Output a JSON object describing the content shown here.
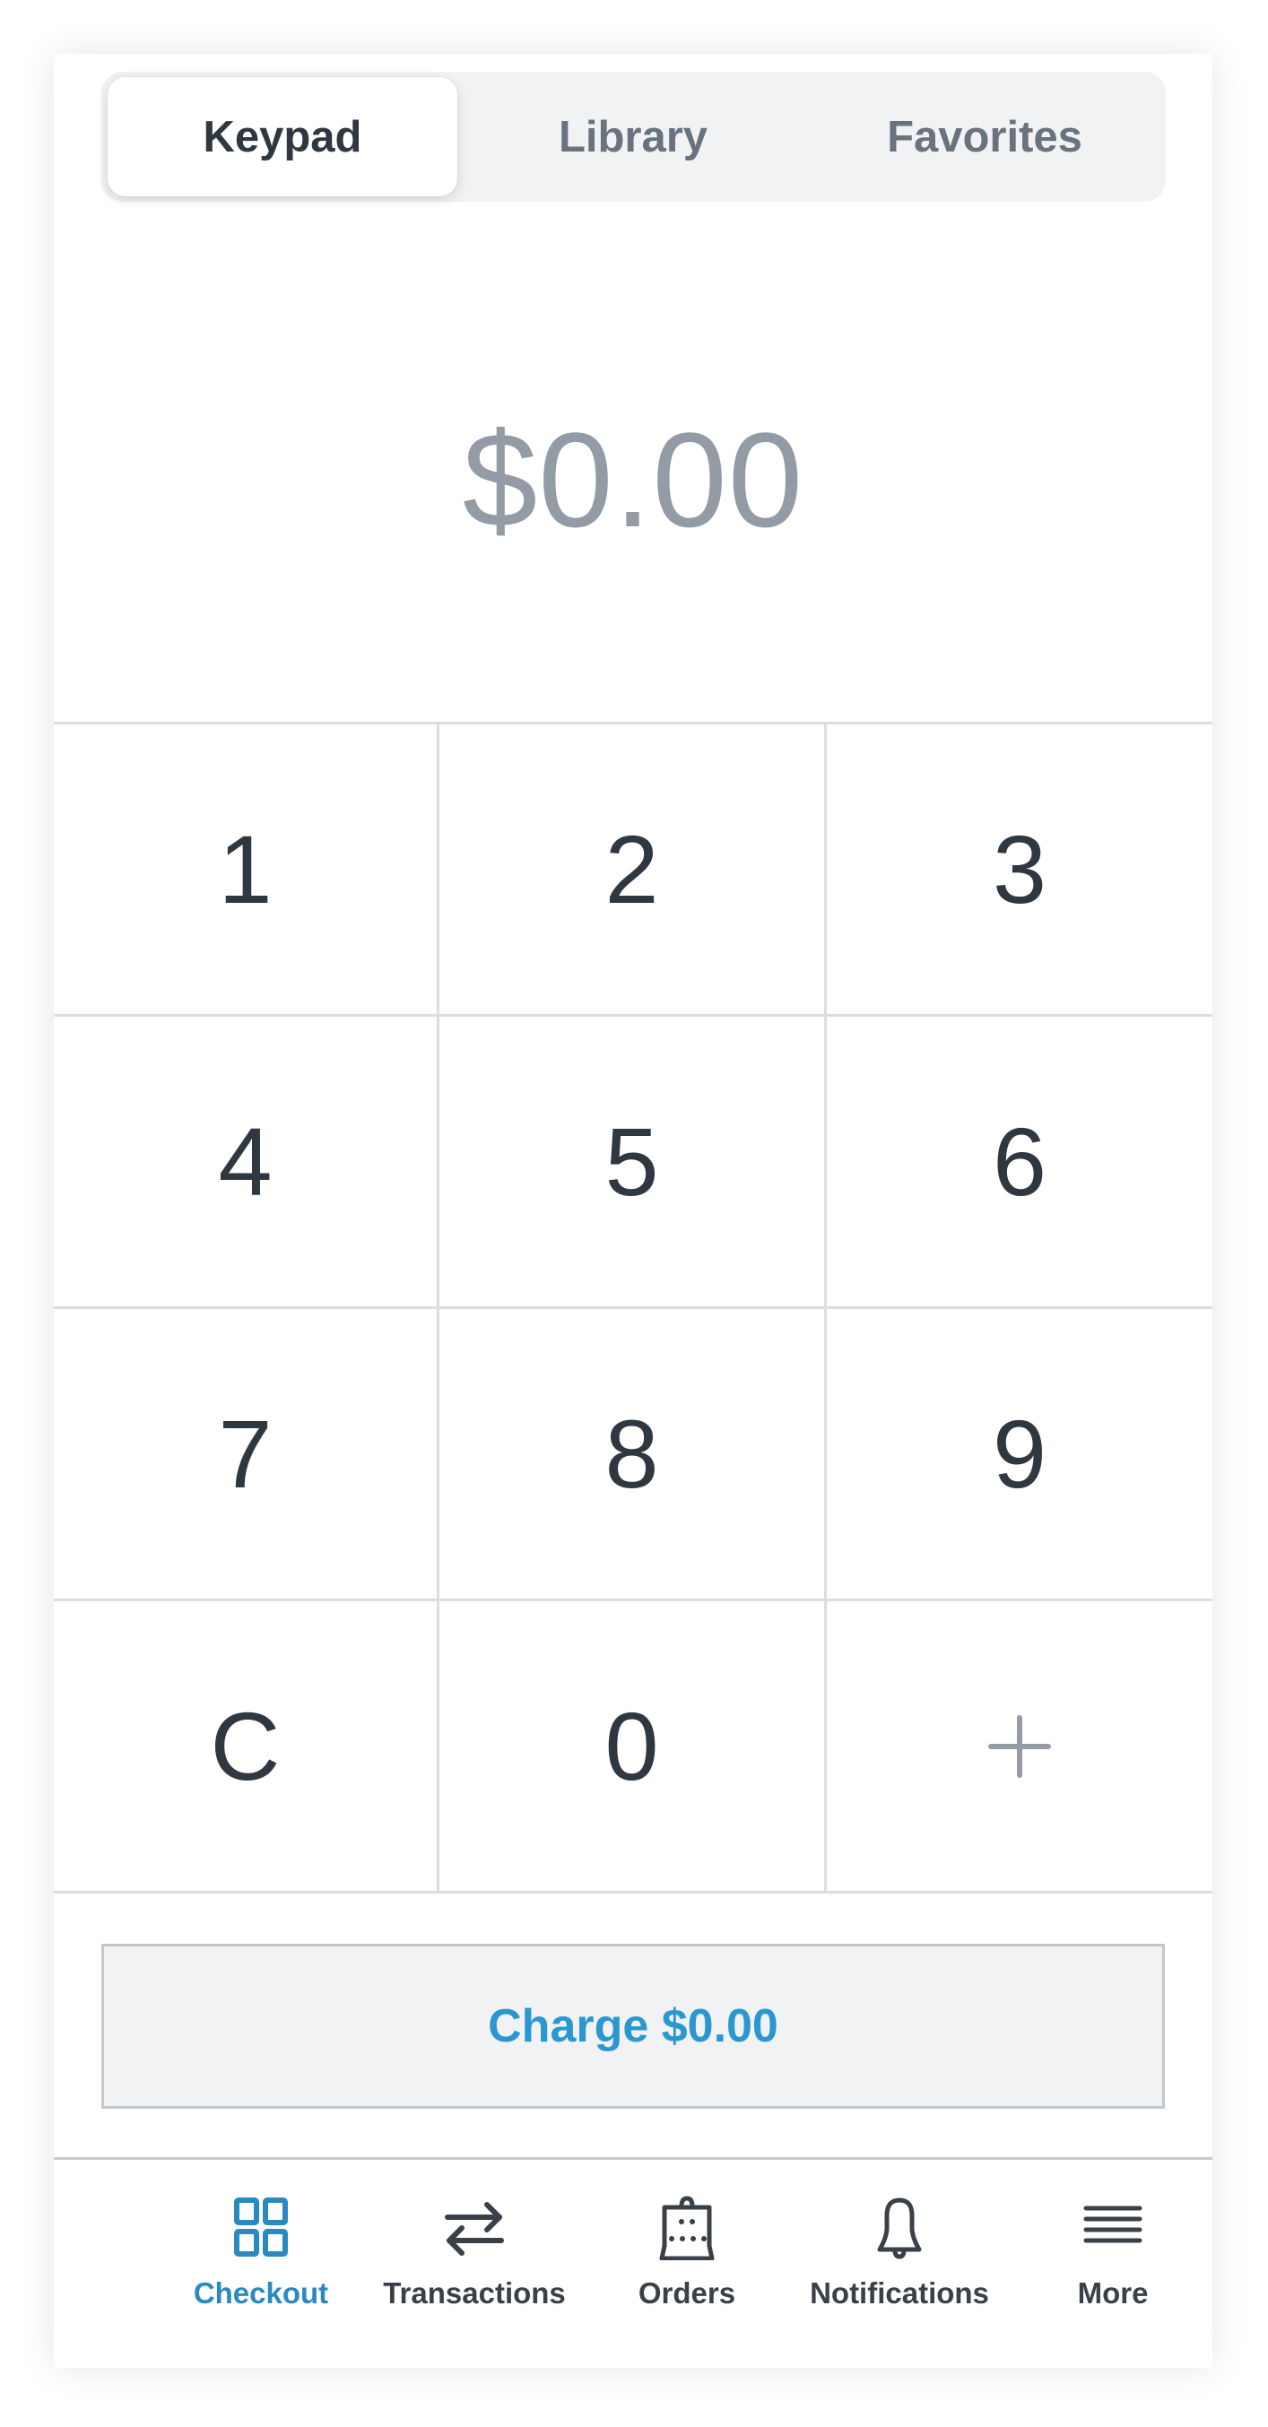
{
  "tabs": [
    {
      "label": "Keypad",
      "active": true
    },
    {
      "label": "Library",
      "active": false
    },
    {
      "label": "Favorites",
      "active": false
    }
  ],
  "amount": "$0.00",
  "keypad": {
    "keys": [
      "1",
      "2",
      "3",
      "4",
      "5",
      "6",
      "7",
      "8",
      "9",
      "C",
      "0"
    ],
    "add_key_icon": "plus-icon"
  },
  "charge_button": {
    "label": "Charge $0.00"
  },
  "bottom_nav": [
    {
      "label": "Checkout",
      "icon": "grid-icon",
      "active": true
    },
    {
      "label": "Transactions",
      "icon": "swap-arrows-icon",
      "active": false
    },
    {
      "label": "Orders",
      "icon": "shopping-bag-icon",
      "active": false
    },
    {
      "label": "Notifications",
      "icon": "bell-icon",
      "active": false
    },
    {
      "label": "More",
      "icon": "menu-icon",
      "active": false
    }
  ],
  "colors": {
    "accent": "#2b97d0",
    "text_primary": "#2f3740",
    "text_secondary": "#69737d",
    "amount_placeholder": "#939ba4"
  }
}
